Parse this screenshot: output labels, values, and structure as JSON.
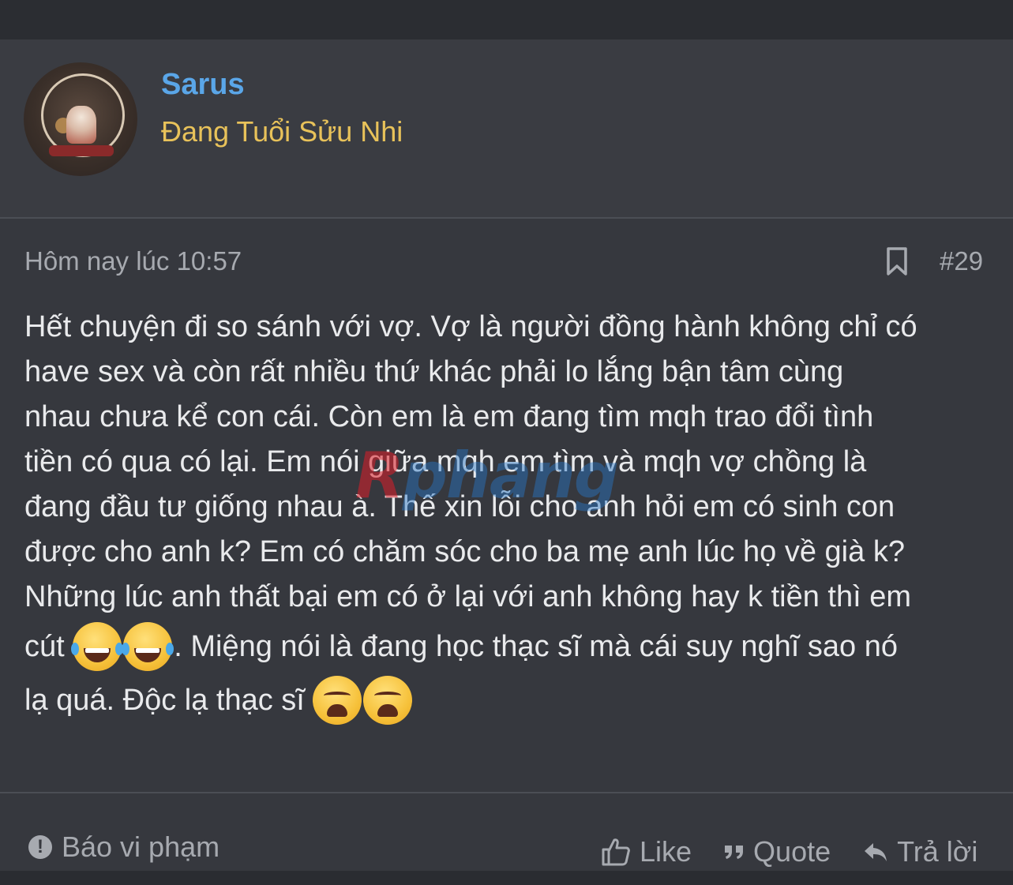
{
  "user": {
    "name": "Sarus",
    "title": "Đang Tuổi Sửu Nhi"
  },
  "post": {
    "time": "Hôm nay lúc 10:57",
    "number": "#29",
    "lines": [
      "Hết chuyện đi so sánh với vợ. Vợ là người đồng hành không chỉ có",
      "have sex và còn rất nhiều thứ khác phải lo lắng bận tâm cùng",
      "nhau chưa kể con cái. Còn em là em đang tìm mqh trao đổi tình",
      "tiền có qua có lại. Em nói giữa mqh em tìm và mqh vợ chồng là",
      "đang đầu tư giống nhau à. Thế xin lỗi cho anh hỏi em có sinh con",
      "được cho anh k? Em có chăm sóc cho ba mẹ anh lúc họ về già k?",
      "Những lúc anh thất bại em có ở lại với anh không hay k tiền thì em"
    ],
    "line8_pre": "cút ",
    "line8_post": ". Miệng nói là đang học thạc sĩ mà cái suy nghĩ sao nó",
    "line9": "lạ quá. Độc lạ thạc sĩ ",
    "emoji_laugh": "face-with-tears-of-joy",
    "emoji_weary": "weary-face"
  },
  "watermark": {
    "r": "R",
    "rest": "phang"
  },
  "footer": {
    "report_label": "Báo vi phạm",
    "like_label": "Like",
    "quote_label": "Quote",
    "reply_label": "Trả lời"
  },
  "colors": {
    "username": "#5aa6e8",
    "usertitle": "#e8c25a",
    "background": "#36383e"
  }
}
